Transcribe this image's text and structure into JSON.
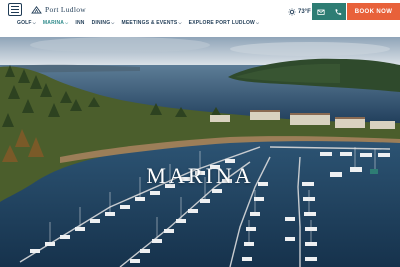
{
  "header": {
    "logo_text": "Port Ludlow",
    "nav": [
      {
        "label": "GOLF",
        "has_dropdown": true,
        "active": false
      },
      {
        "label": "MARINA",
        "has_dropdown": true,
        "active": true
      },
      {
        "label": "INN",
        "has_dropdown": false,
        "active": false
      },
      {
        "label": "DINING",
        "has_dropdown": true,
        "active": false
      },
      {
        "label": "MEETINGS & EVENTS",
        "has_dropdown": true,
        "active": false
      },
      {
        "label": "EXPLORE PORT LUDLOW",
        "has_dropdown": true,
        "active": false
      }
    ],
    "weather": {
      "temperature": "73°F",
      "icon": "sun-icon"
    },
    "email_icon": "envelope-icon",
    "phone_icon": "phone-icon",
    "book_label": "BOOK NOW"
  },
  "hero": {
    "title": "MARINA"
  },
  "colors": {
    "navy": "#1f3b55",
    "teal": "#2e7d74",
    "active_nav": "#2e8a8a",
    "book_orange": "#e8613a"
  }
}
